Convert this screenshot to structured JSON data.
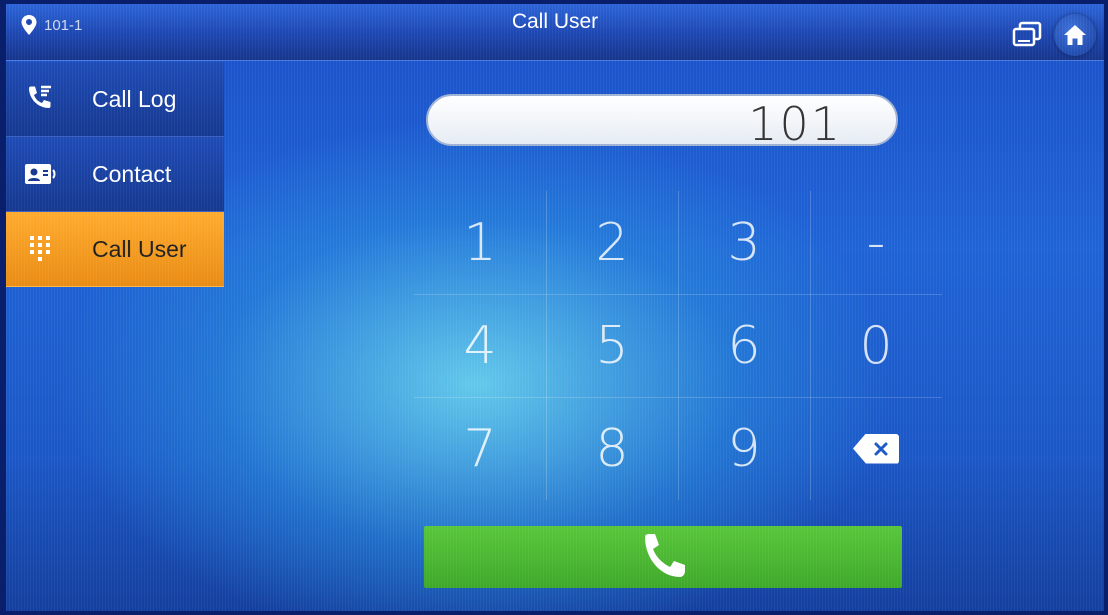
{
  "header": {
    "location_label": "101-1",
    "title": "Call User"
  },
  "sidebar": {
    "items": [
      {
        "label": "Call Log",
        "icon": "call-log-icon",
        "active": false
      },
      {
        "label": "Contact",
        "icon": "contact-card-icon",
        "active": false
      },
      {
        "label": "Call User",
        "icon": "dialpad-icon",
        "active": true
      }
    ]
  },
  "dialer": {
    "number": "101",
    "keys": [
      "1",
      "2",
      "3",
      "-",
      "4",
      "5",
      "6",
      "0",
      "7",
      "8",
      "9"
    ],
    "delete_icon": "backspace-icon",
    "call_icon": "phone-handset-icon"
  },
  "colors": {
    "active_tab": "#f5a020",
    "call_button": "#4bb631",
    "topbar": "#1d46b0"
  }
}
